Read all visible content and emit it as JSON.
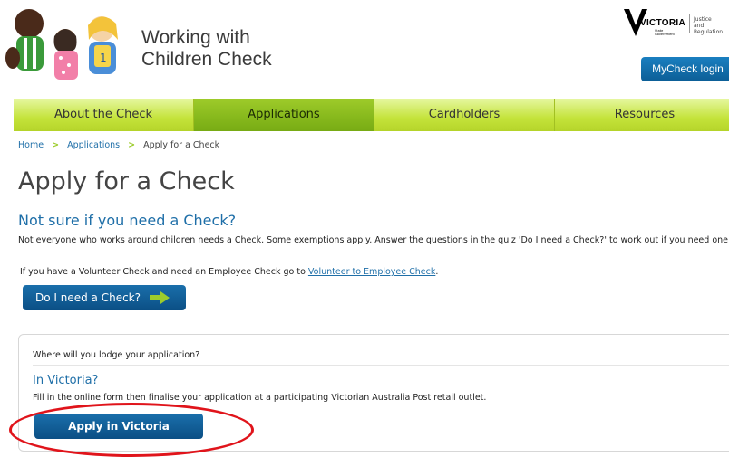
{
  "header": {
    "site_title_line1": "Working with",
    "site_title_line2": "Children Check",
    "gov_logo_word": "VICTORIA",
    "gov_logo_sub1": "State",
    "gov_logo_sub2": "Government",
    "dept_line1": "Justice",
    "dept_line2": "and Regulation",
    "mycheck_label": "MyCheck login"
  },
  "nav": {
    "items": [
      {
        "label": "About the Check",
        "active": false
      },
      {
        "label": "Applications",
        "active": true
      },
      {
        "label": "Cardholders",
        "active": false
      },
      {
        "label": "Resources",
        "active": false
      }
    ]
  },
  "breadcrumb": {
    "home": "Home",
    "applications": "Applications",
    "current": "Apply for a Check",
    "separator": ">"
  },
  "main": {
    "title": "Apply for a Check",
    "subheading": "Not sure if you need a Check?",
    "intro": "Not everyone who works around children needs a Check. Some exemptions apply. Answer the questions in the quiz 'Do I need a Check?' to work out if you need one.",
    "volunteer_prefix": "If you have a Volunteer Check and need an Employee Check go to ",
    "volunteer_link": "Volunteer to Employee Check",
    "volunteer_suffix": ".",
    "need_check_button": "Do I need a Check?"
  },
  "lodge": {
    "question": "Where will you lodge your application?",
    "in_victoria_heading": "In Victoria?",
    "in_victoria_text": "Fill in the online form then finalise your application at a participating Victorian Australia Post retail outlet.",
    "apply_button": "Apply in Victoria"
  },
  "colors": {
    "nav_green": "#c4e33a",
    "nav_active": "#86b81c",
    "link_blue": "#1f6fa8",
    "button_blue": "#0b4f85",
    "highlight_red": "#e0141b"
  },
  "icons": [
    "children-illustration-icon",
    "victoria-logo-icon",
    "arrow-right-icon"
  ]
}
